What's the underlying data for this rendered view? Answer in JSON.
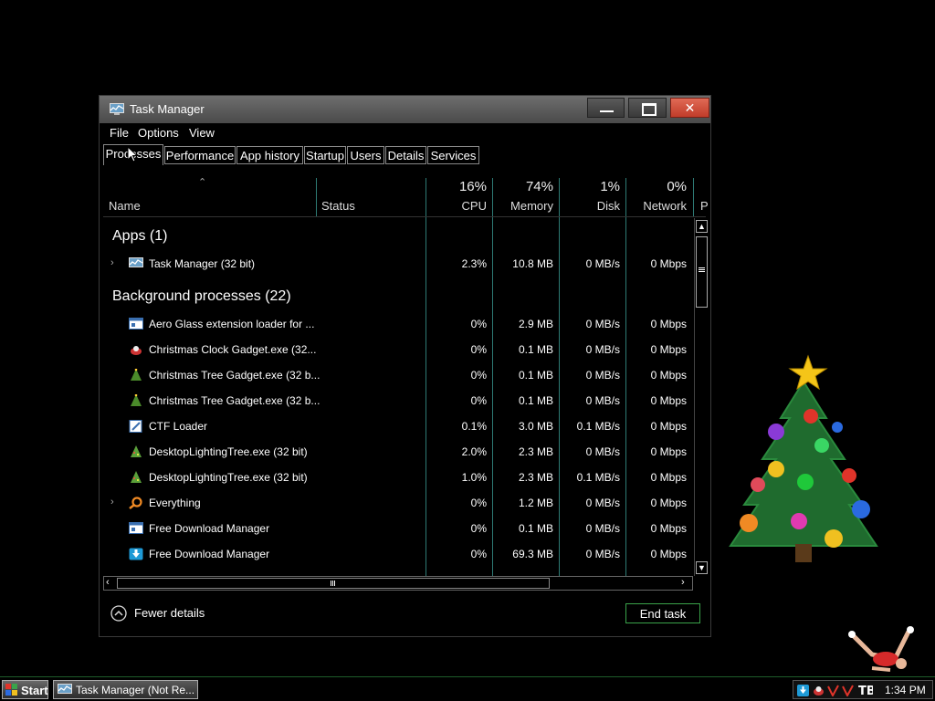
{
  "window": {
    "title": "Task Manager",
    "minimize_icon": "minimize-icon",
    "maximize_icon": "maximize-icon",
    "close_label": "✕"
  },
  "menu": [
    "File",
    "Options",
    "View"
  ],
  "tabs": [
    "Processes",
    "Performance",
    "App history",
    "Startup",
    "Users",
    "Details",
    "Services"
  ],
  "columns": {
    "name": "Name",
    "status": "Status",
    "cpu": {
      "pct": "16%",
      "label": "CPU"
    },
    "memory": {
      "pct": "74%",
      "label": "Memory"
    },
    "disk": {
      "pct": "1%",
      "label": "Disk"
    },
    "network": {
      "pct": "0%",
      "label": "Network"
    },
    "power": "P"
  },
  "groups": {
    "apps": "Apps (1)",
    "background": "Background processes (22)"
  },
  "apps": [
    {
      "name": "Task Manager (32 bit)",
      "cpu": "2.3%",
      "memory": "10.8 MB",
      "disk": "0 MB/s",
      "network": "0 Mbps",
      "icon": "task-manager-icon"
    }
  ],
  "background": [
    {
      "name": "Aero Glass extension loader for ...",
      "cpu": "0%",
      "memory": "2.9 MB",
      "disk": "0 MB/s",
      "network": "0 Mbps",
      "icon": "window-icon"
    },
    {
      "name": "Christmas Clock Gadget.exe (32...",
      "cpu": "0%",
      "memory": "0.1 MB",
      "disk": "0 MB/s",
      "network": "0 Mbps",
      "icon": "clock-gadget-icon"
    },
    {
      "name": "Christmas Tree Gadget.exe (32 b...",
      "cpu": "0%",
      "memory": "0.1 MB",
      "disk": "0 MB/s",
      "network": "0 Mbps",
      "icon": "tree-icon"
    },
    {
      "name": "Christmas Tree Gadget.exe (32 b...",
      "cpu": "0%",
      "memory": "0.1 MB",
      "disk": "0 MB/s",
      "network": "0 Mbps",
      "icon": "tree-icon"
    },
    {
      "name": "CTF Loader",
      "cpu": "0.1%",
      "memory": "3.0 MB",
      "disk": "0.1 MB/s",
      "network": "0 Mbps",
      "icon": "ctf-icon"
    },
    {
      "name": "DesktopLightingTree.exe (32 bit)",
      "cpu": "2.0%",
      "memory": "2.3 MB",
      "disk": "0 MB/s",
      "network": "0 Mbps",
      "icon": "lighting-tree-icon"
    },
    {
      "name": "DesktopLightingTree.exe (32 bit)",
      "cpu": "1.0%",
      "memory": "2.3 MB",
      "disk": "0.1 MB/s",
      "network": "0 Mbps",
      "icon": "lighting-tree-icon"
    },
    {
      "name": "Everything",
      "cpu": "0%",
      "memory": "1.2 MB",
      "disk": "0 MB/s",
      "network": "0 Mbps",
      "icon": "magnifier-icon"
    },
    {
      "name": "Free Download Manager",
      "cpu": "0%",
      "memory": "0.1 MB",
      "disk": "0 MB/s",
      "network": "0 Mbps",
      "icon": "window-icon"
    },
    {
      "name": "Free Download Manager",
      "cpu": "0%",
      "memory": "69.3 MB",
      "disk": "0 MB/s",
      "network": "0 Mbps",
      "icon": "download-icon"
    }
  ],
  "footer": {
    "fewer_details": "Fewer details",
    "end_task": "End task"
  },
  "taskbar": {
    "start": "Start",
    "task_button": "Task Manager (Not Re...",
    "clock": "1:34 PM"
  },
  "colors": {
    "accent_green": "#3aa34a",
    "close_red": "#c13c2a",
    "column_sep": "#2e7a74"
  }
}
